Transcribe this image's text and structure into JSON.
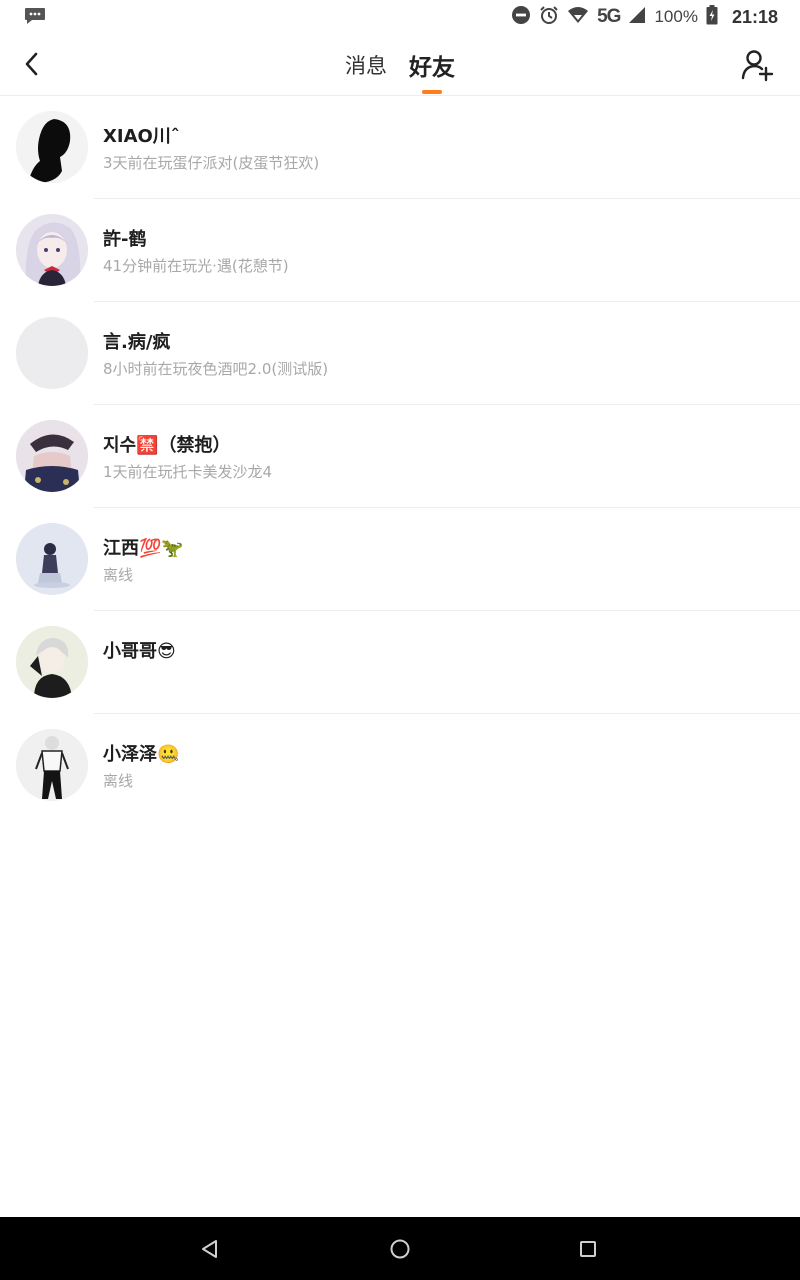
{
  "status_bar": {
    "battery": "100%",
    "network": "5G",
    "time": "21:18"
  },
  "header": {
    "tabs": [
      {
        "label": "消息",
        "active": false
      },
      {
        "label": "好友",
        "active": true
      }
    ],
    "accent_color": "#ff7d1a"
  },
  "friends": [
    {
      "name": "XIAO川ˆ",
      "status": "3天前在玩蛋仔派对(皮蛋节狂欢)"
    },
    {
      "name": "許-鹤",
      "status": "41分钟前在玩光·遇(花憩节)"
    },
    {
      "name": "言.病/疯",
      "status": "8小时前在玩夜色酒吧2.0(测试版)"
    },
    {
      "name": "지수🈲（禁抱）",
      "status": "1天前在玩托卡美发沙龙4"
    },
    {
      "name": "江西💯🦖",
      "status": "离线"
    },
    {
      "name": "小哥哥😎",
      "status": ""
    },
    {
      "name": "小泽泽🤐",
      "status": "离线"
    }
  ]
}
